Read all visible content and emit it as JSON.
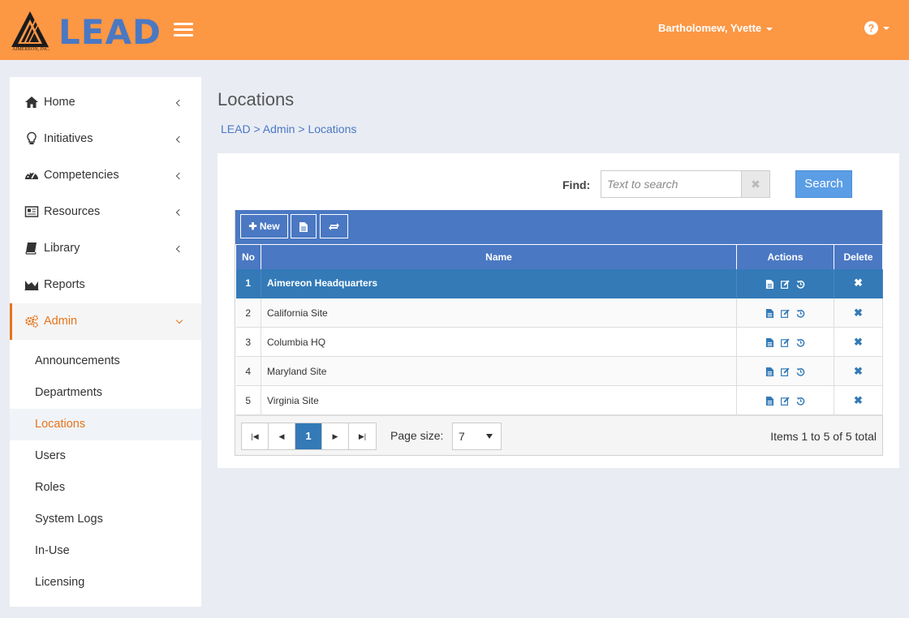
{
  "header": {
    "logo_text": "LEAD",
    "logo_company": "AIMEREON, INC.",
    "user_name": "Bartholomew, Yvette",
    "help_glyph": "?",
    "color": "#fc9744"
  },
  "sidebar": {
    "items": [
      {
        "label": "Home",
        "icon": "home-icon"
      },
      {
        "label": "Initiatives",
        "icon": "lightbulb-icon"
      },
      {
        "label": "Competencies",
        "icon": "dashboard-icon"
      },
      {
        "label": "Resources",
        "icon": "newspaper-icon"
      },
      {
        "label": "Library",
        "icon": "book-icon"
      },
      {
        "label": "Reports",
        "icon": "area-chart-icon"
      },
      {
        "label": "Admin",
        "icon": "gears-icon"
      }
    ],
    "admin_subitems": [
      "Announcements",
      "Departments",
      "Locations",
      "Users",
      "Roles",
      "System Logs",
      "In-Use",
      "Licensing"
    ],
    "active_subitem": "Locations"
  },
  "main": {
    "title": "Locations",
    "breadcrumb": [
      "LEAD",
      "Admin",
      "Locations"
    ],
    "breadcrumb_sep": ">"
  },
  "search": {
    "label": "Find:",
    "placeholder": "Text to search",
    "clear_glyph": "✖",
    "button": "Search"
  },
  "grid": {
    "toolbar": {
      "new_label": "New"
    },
    "columns": [
      "No",
      "Name",
      "Actions",
      "Delete"
    ],
    "rows": [
      {
        "no": "1",
        "name": "Aimereon Headquarters"
      },
      {
        "no": "2",
        "name": "California Site"
      },
      {
        "no": "3",
        "name": "Columbia HQ"
      },
      {
        "no": "4",
        "name": "Maryland Site"
      },
      {
        "no": "5",
        "name": "Virginia Site"
      }
    ],
    "selected_row": 1,
    "delete_glyph": "✖",
    "accent": "#4a78c3",
    "select_color": "#337ab7"
  },
  "pager": {
    "current_page": "1",
    "page_size_label": "Page size:",
    "page_size": "7",
    "info": "Items 1 to 5 of 5 total"
  }
}
